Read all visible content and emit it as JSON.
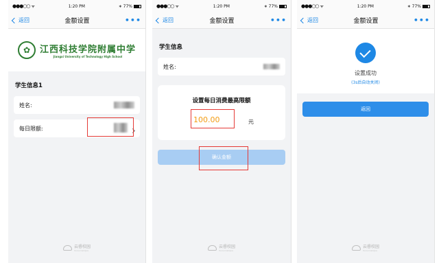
{
  "status": {
    "signal": "●●●○○",
    "wifi": "ᯤ",
    "time": "1:20 PM",
    "bluetooth": "∗",
    "battery": "77%"
  },
  "nav": {
    "back": "返回",
    "title": "金额设置",
    "more": "•••"
  },
  "screen1": {
    "school_cn": "江西科技学院附属中学",
    "school_en": "Jiangxi University of Technology High School",
    "section": "学生信息1",
    "name_label": "姓名:",
    "limit_label": "每日限额:"
  },
  "screen2": {
    "section": "学生信息",
    "name_label": "姓名:",
    "card_title": "设置每日消费最高限额",
    "amount": "100.00",
    "unit": "元",
    "confirm": "确认金额"
  },
  "screen3": {
    "success": "设置成功",
    "hint": "(3s后自动关闭)",
    "return": "返回"
  },
  "footer": {
    "brand": "云睿校园",
    "sub": "Yunrui Campus"
  },
  "colors": {
    "accent": "#1e88e5",
    "highlight": "#e53935",
    "amount": "#f39c12",
    "school": "#2e7d32"
  }
}
